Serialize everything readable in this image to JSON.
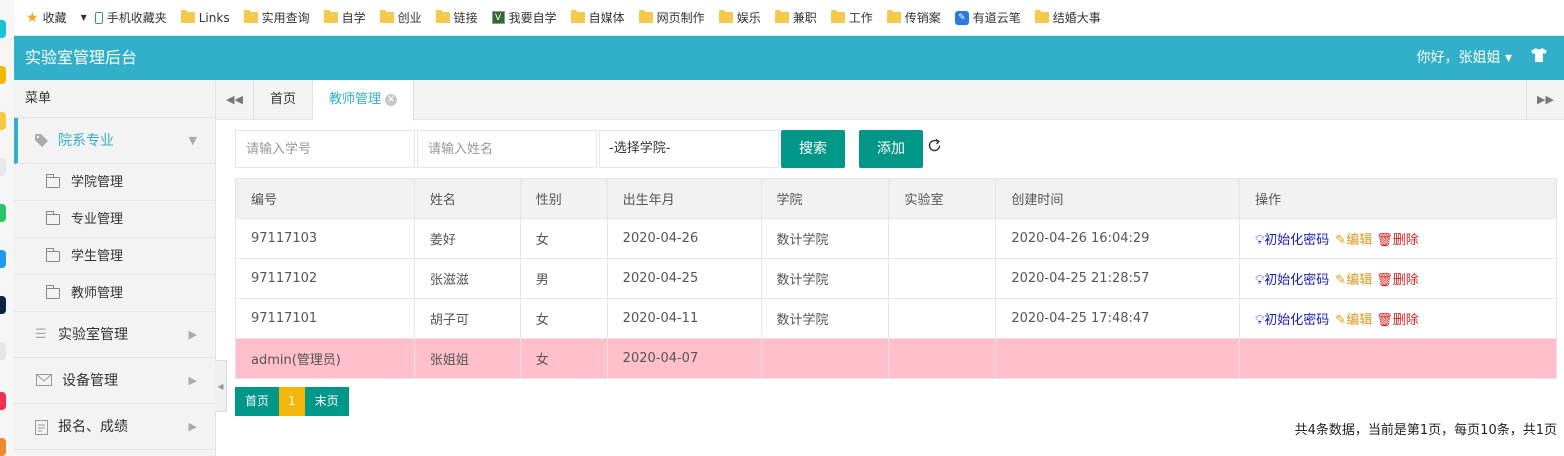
{
  "bookmarks": [
    {
      "label": "收藏",
      "icon": "star-icon"
    },
    {
      "label": "手机收藏夹",
      "icon": "phone-icon"
    },
    {
      "label": "Links",
      "icon": "folder-icon"
    },
    {
      "label": "实用查询",
      "icon": "folder-icon"
    },
    {
      "label": "自学",
      "icon": "folder-icon"
    },
    {
      "label": "创业",
      "icon": "folder-icon"
    },
    {
      "label": "链接",
      "icon": "folder-icon"
    },
    {
      "label": "我要自学",
      "icon": "site-icon"
    },
    {
      "label": "自媒体",
      "icon": "folder-icon"
    },
    {
      "label": "网页制作",
      "icon": "folder-icon"
    },
    {
      "label": "娱乐",
      "icon": "folder-icon"
    },
    {
      "label": "兼职",
      "icon": "folder-icon"
    },
    {
      "label": "工作",
      "icon": "folder-icon"
    },
    {
      "label": "传销案",
      "icon": "folder-icon"
    },
    {
      "label": "有道云笔",
      "icon": "youdao-icon"
    },
    {
      "label": "结婚大事",
      "icon": "folder-icon"
    }
  ],
  "header": {
    "title": "实验室管理后台",
    "greeting": "你好，张姐姐 ▾",
    "theme_icon": "shirt-icon",
    "color": "#33b0c9"
  },
  "sidebar": {
    "heading": "菜单",
    "groups": [
      {
        "label": "院系专业",
        "icon": "tag-icon",
        "expanded": true,
        "items": [
          "学院管理",
          "专业管理",
          "学生管理",
          "教师管理"
        ]
      },
      {
        "label": "实验室管理",
        "icon": "list-icon"
      },
      {
        "label": "设备管理",
        "icon": "mail-icon"
      },
      {
        "label": "报名、成绩",
        "icon": "note-icon"
      }
    ]
  },
  "tabs": {
    "home": "首页",
    "active": "教师管理"
  },
  "toolbar": {
    "id_placeholder": "请输入学号",
    "name_placeholder": "请输入姓名",
    "college_select": "-选择学院-",
    "search_label": "搜索",
    "add_label": "添加",
    "accent": "#009688"
  },
  "table": {
    "columns": [
      "编号",
      "姓名",
      "性别",
      "出生年月",
      "学院",
      "实验室",
      "创建时间",
      "操作"
    ],
    "rows": [
      {
        "id": "97117103",
        "name": "姜好",
        "gender": "女",
        "birth": "2020-04-26",
        "college": "数计学院",
        "lab": "",
        "created": "2020-04-26 16:04:29"
      },
      {
        "id": "97117102",
        "name": "张滋滋",
        "gender": "男",
        "birth": "2020-04-25",
        "college": "数计学院",
        "lab": "",
        "created": "2020-04-25 21:28:57"
      },
      {
        "id": "97117101",
        "name": "胡子可",
        "gender": "女",
        "birth": "2020-04-11",
        "college": "数计学院",
        "lab": "",
        "created": "2020-04-25 17:48:47"
      },
      {
        "id": "admin(管理员)",
        "name": "张姐姐",
        "gender": "女",
        "birth": "2020-04-07",
        "college": "",
        "lab": "",
        "created": ""
      }
    ],
    "actions": {
      "reset": "初始化密码",
      "edit": "编辑",
      "delete": "删除"
    },
    "highlight_color": "#ffc0cb"
  },
  "pager": {
    "first": "首页",
    "current": "1",
    "last": "末页",
    "summary": "共4条数据，当前是第1页，每页10条，共1页"
  }
}
